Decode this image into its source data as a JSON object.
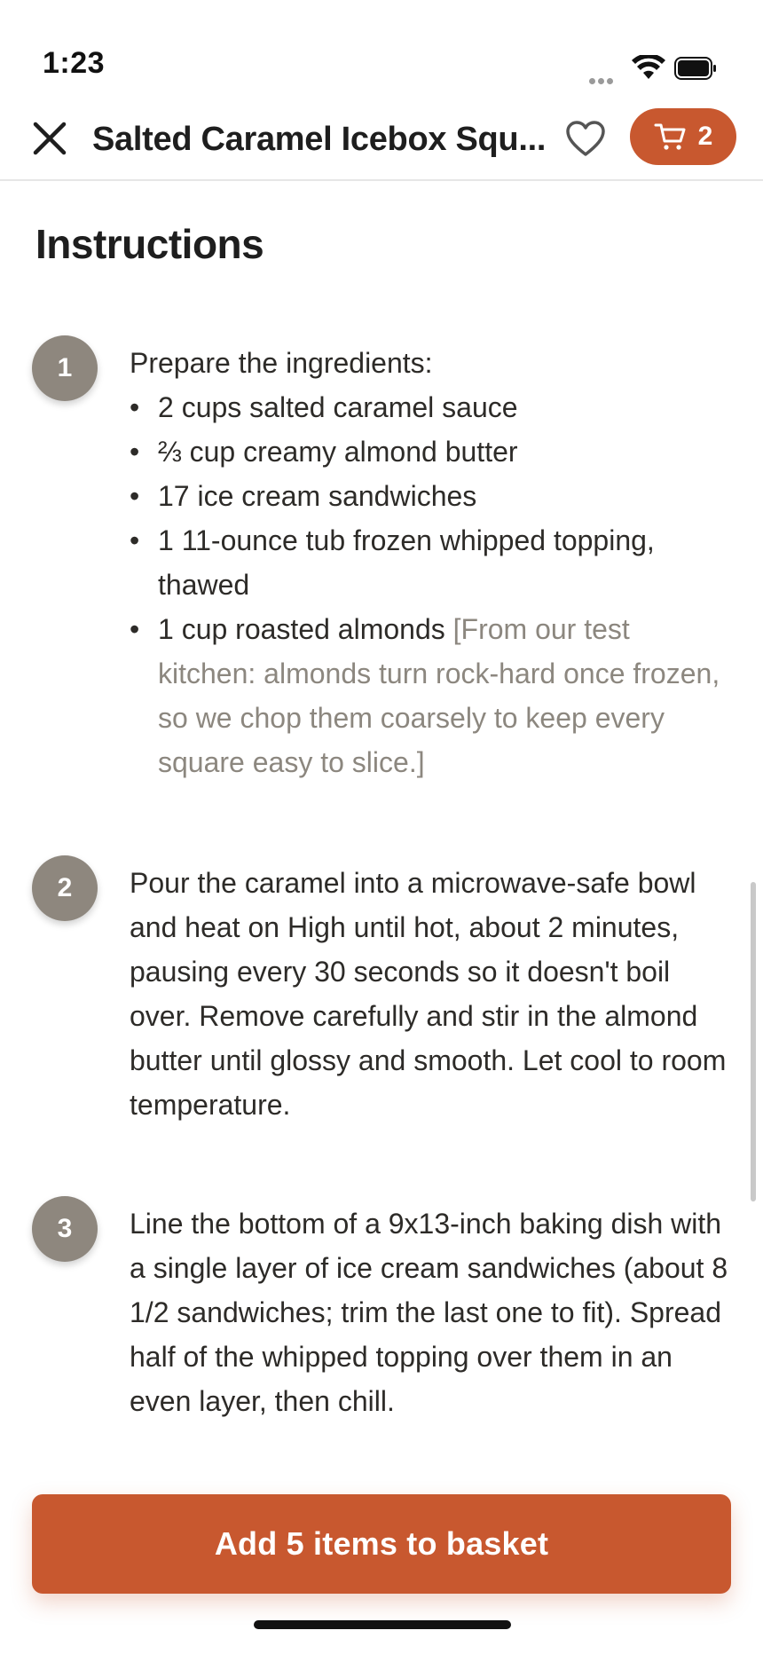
{
  "status_bar": {
    "time": "1:23"
  },
  "header": {
    "title": "Salted Caramel Icebox Squ...",
    "cart_count": "2",
    "close_icon": "close-icon",
    "favorite_icon": "heart-icon",
    "cart_icon": "cart-icon"
  },
  "instructions": {
    "heading": "Instructions",
    "steps": [
      {
        "number": "1",
        "intro": "Prepare the ingredients:",
        "ingredients": [
          "2 cups salted caramel sauce",
          "⅔ cup creamy almond butter",
          "17 ice cream sandwiches",
          "1 11-ounce tub frozen whipped topping, thawed",
          "1 cup roasted almonds"
        ],
        "last_ingredient_note": "[From our test kitchen: almonds turn rock-hard once frozen, so we chop them coarsely to keep every square easy to slice.]"
      },
      {
        "number": "2",
        "text": "Pour the caramel into a microwave-safe bowl and heat on High until hot, about 2 minutes, pausing every 30 seconds so it doesn't boil over. Remove carefully and stir in the almond butter until glossy and smooth. Let cool to room temperature."
      },
      {
        "number": "3",
        "text": "Line the bottom of a 9x13-inch baking dish with a single layer of ice cream sandwiches (about 8 1/2 sandwiches; trim the last one to fit). Spread half of the whipped topping over them in an even layer, then chill."
      }
    ]
  },
  "footer": {
    "add_button_label": "Add 5 items to basket"
  },
  "colors": {
    "accent": "#c8582f",
    "step_badge": "#8e877e",
    "note_text": "#8c877f"
  }
}
